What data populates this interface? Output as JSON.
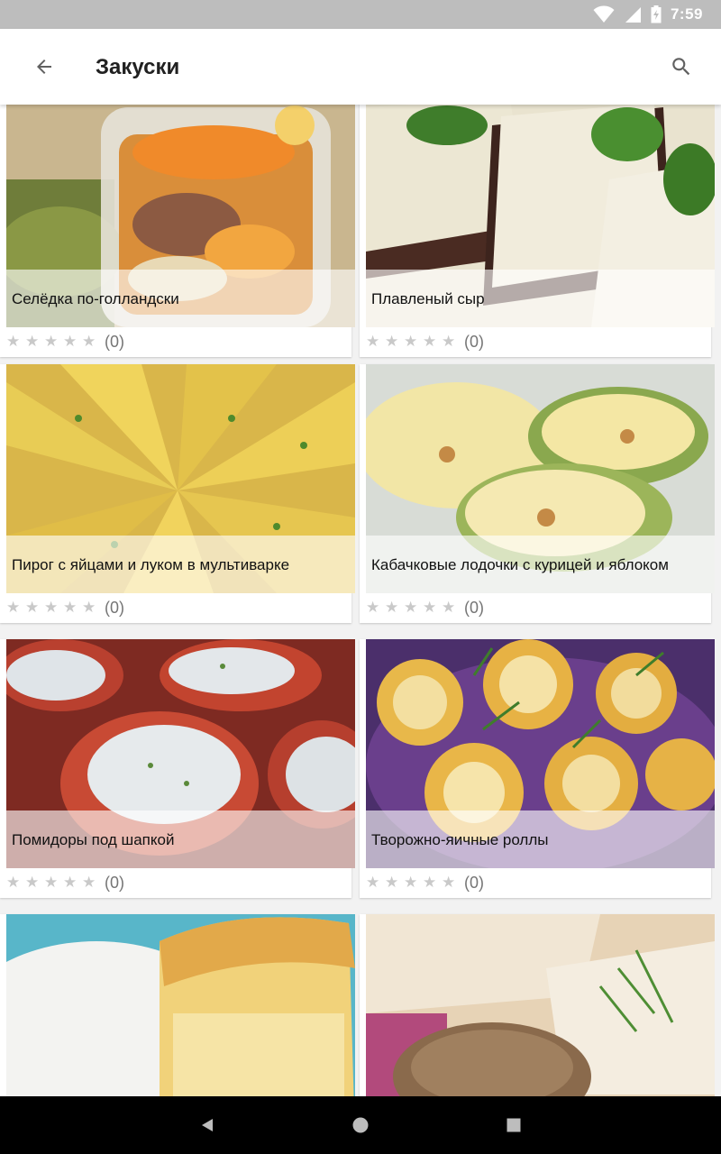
{
  "status_bar": {
    "time": "7:59",
    "icons": [
      "wifi-icon",
      "signal-icon",
      "battery-charging-icon"
    ]
  },
  "app_bar": {
    "title": "Закуски",
    "back_icon": "arrow-back-icon",
    "search_icon": "search-icon"
  },
  "rating_max": 5,
  "recipes": [
    {
      "title": "Селёдка по-голландски",
      "rating_count": "(0)"
    },
    {
      "title": "Плавленый сыр",
      "rating_count": "(0)"
    },
    {
      "title": "Пирог с яйцами и луком в мультиварке",
      "rating_count": "(0)"
    },
    {
      "title": "Кабачковые лодочки с курицей и яблоком",
      "rating_count": "(0)"
    },
    {
      "title": "Помидоры под шапкой",
      "rating_count": "(0)"
    },
    {
      "title": "Творожно-яичные роллы",
      "rating_count": "(0)"
    },
    {
      "title": "",
      "rating_count": ""
    },
    {
      "title": "",
      "rating_count": ""
    }
  ],
  "nav_bar": {
    "icons": [
      "back-triangle-icon",
      "home-circle-icon",
      "recents-square-icon"
    ]
  },
  "colors": {
    "status_bar": "#bdbdbd",
    "app_bar": "#ffffff",
    "background": "#f2f2f2",
    "star_empty": "#c9c9c9",
    "nav_bar": "#000000"
  }
}
